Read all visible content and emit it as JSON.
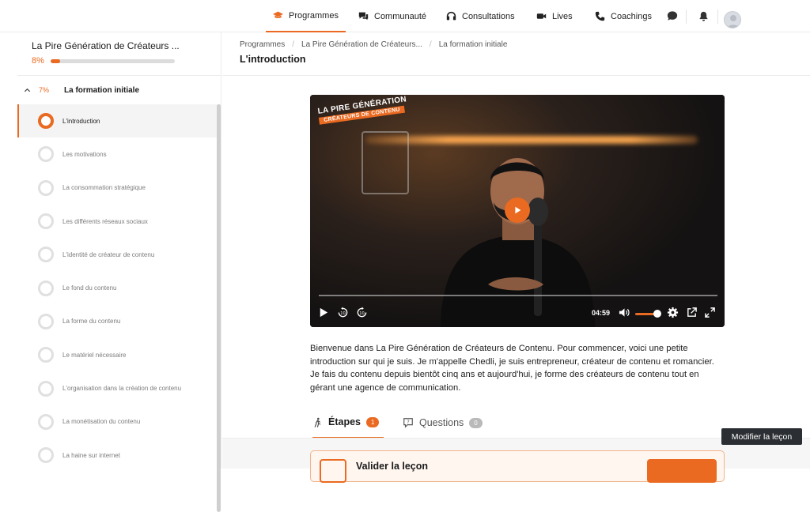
{
  "nav": {
    "items": [
      {
        "label": "Programmes",
        "icon": "graduation-cap-icon",
        "active": true
      },
      {
        "label": "Communauté",
        "icon": "chat-bubbles-icon"
      },
      {
        "label": "Consultations",
        "icon": "headset-icon"
      },
      {
        "label": "Lives",
        "icon": "video-camera-icon"
      },
      {
        "label": "Coachings",
        "icon": "phone-icon"
      }
    ],
    "icons": [
      "message-icon",
      "bell-icon",
      "avatar"
    ]
  },
  "course": {
    "title": "La Pire Génération de Créateurs ...",
    "progress_label": "8%",
    "progress": 0.08
  },
  "section": {
    "progress_label": "7%",
    "title": "La formation initiale",
    "lessons": [
      {
        "label": "L'introduction",
        "active": true
      },
      {
        "label": "Les motivations"
      },
      {
        "label": "La consommation stratégique"
      },
      {
        "label": "Les différents réseaux sociaux"
      },
      {
        "label": "L'identité de créateur de contenu"
      },
      {
        "label": "Le fond du contenu"
      },
      {
        "label": "La forme du contenu"
      },
      {
        "label": "Le matériel nécessaire"
      },
      {
        "label": "L'organisation dans la création de contenu"
      },
      {
        "label": "La monétisation du contenu"
      },
      {
        "label": "La haine sur internet"
      }
    ]
  },
  "breadcrumb": [
    "Programmes",
    "La Pire Génération de Créateurs...",
    "La formation initiale"
  ],
  "page_title": "L'introduction",
  "video": {
    "logo_line1": "LA PIRE GÉNÉRATION",
    "logo_line2": "CRÉATEURS DE CONTENU",
    "time": "04:59",
    "volume": 0.75
  },
  "description": "Bienvenue dans La Pire Génération de Créateurs de Contenu. Pour commencer, voici une petite introduction sur qui je suis. Je m'appelle Chedli, je suis entrepreneur, créateur de contenu et romancier. Je fais du contenu depuis bientôt cinq ans et aujourd'hui, je forme des créateurs de contenu tout en gérant une agence de communication.",
  "tabs": [
    {
      "label": "Étapes",
      "count": "1",
      "active": true,
      "badge_color": "#ea6a21"
    },
    {
      "label": "Questions",
      "count": "0",
      "badge_color": "#b9b9b9"
    }
  ],
  "validate": {
    "title": "Valider la leçon"
  },
  "tooltip": "Modifier la leçon",
  "colors": {
    "accent": "#ea6a21"
  }
}
